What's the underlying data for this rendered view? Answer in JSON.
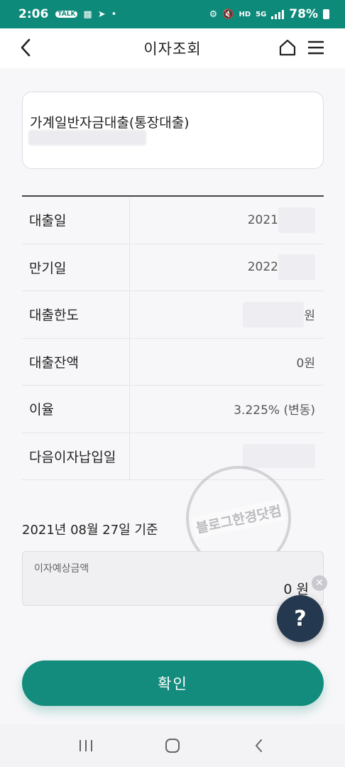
{
  "status_bar": {
    "time": "2:06",
    "left_icons": [
      "talk-icon",
      "puzzle-icon",
      "telegram-icon",
      "dot-icon"
    ],
    "right_icons": [
      "key-icon",
      "mute-icon",
      "hd-voice-icon",
      "5g-icon",
      "signal-icon"
    ],
    "battery": "78%"
  },
  "app_bar": {
    "title": "이자조회"
  },
  "product": {
    "name": "가계일반자금대출(통장대출)"
  },
  "info_rows": [
    {
      "label": "대출일",
      "value": "2021"
    },
    {
      "label": "만기일",
      "value": "2022"
    },
    {
      "label": "대출한도",
      "value": "원"
    },
    {
      "label": "대출잔액",
      "value": "0원"
    },
    {
      "label": "이율",
      "value": "3.225% (변동)"
    },
    {
      "label": "다음이자납입일",
      "value": ""
    }
  ],
  "base_date": "2021년 08월 27일 기준",
  "interest": {
    "label": "이자예상금액",
    "value": "0 원"
  },
  "watermark": "블로그한경닷컴",
  "confirm_label": "확인",
  "colors": {
    "accent": "#138c7d",
    "fab": "#24394f"
  }
}
